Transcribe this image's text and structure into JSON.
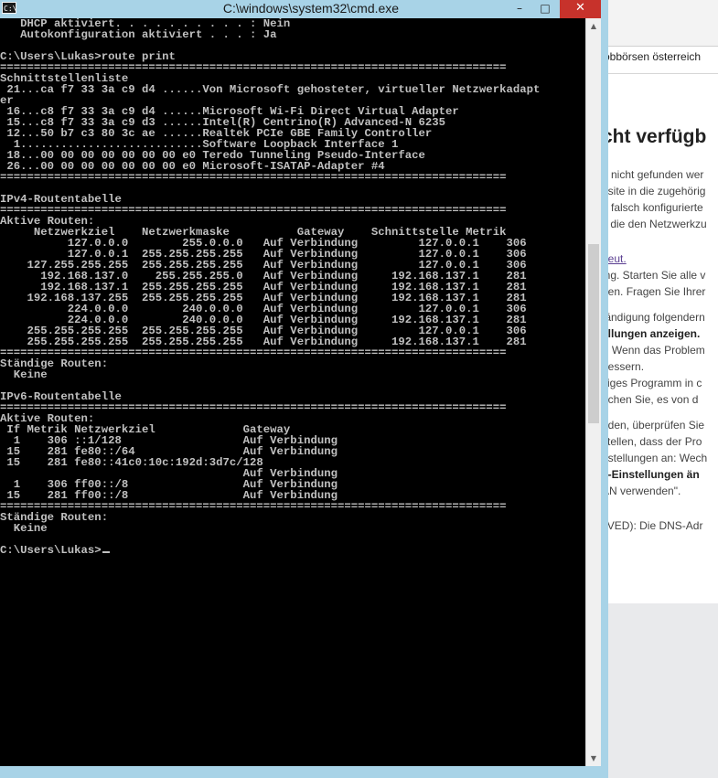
{
  "browser": {
    "bookmark": "obbörsen österreich",
    "heading": "cht verfügb",
    "lines": [
      {
        "text": "n nicht gefunden wer",
        "style": "p"
      },
      {
        "text": "osite in die zugehörig",
        "style": "p"
      },
      {
        "text": "n falsch konfigurierte",
        "style": "p"
      },
      {
        "text": "l, die den Netzwerkzu",
        "style": "p"
      },
      {
        "text": "",
        "style": "gap"
      },
      {
        "text": "",
        "style": "gap"
      },
      {
        "text": "neut.",
        "style": "link"
      },
      {
        "text": "ing. Starten Sie alle v",
        "style": "p"
      },
      {
        "text": "gen. Fragen Sie Ihrer",
        "style": "p"
      },
      {
        "text": "",
        "style": "gap"
      },
      {
        "text": "tändigung folgendern",
        "style": "p"
      },
      {
        "text": "ellungen anzeigen.",
        "style": "bold"
      },
      {
        "text": "\". Wenn das Problem",
        "style": "p"
      },
      {
        "text": "bessern.",
        "style": "p"
      },
      {
        "text": "siges Programm in c",
        "style": "p"
      },
      {
        "text": "uchen Sie, es von d",
        "style": "p"
      },
      {
        "text": "",
        "style": "gap"
      },
      {
        "text": "nden, überprüfen Sie",
        "style": "p"
      },
      {
        "text": "stellen, dass der Pro",
        "style": "p"
      },
      {
        "text": "nstellungen an: Wech",
        "style": "p"
      },
      {
        "text": "y-Einstellungen än",
        "style": "bold"
      },
      {
        "text": "AN verwenden\".",
        "style": "p"
      },
      {
        "text": "",
        "style": "gap"
      },
      {
        "text": "",
        "style": "gap"
      },
      {
        "text": "LVED): Die DNS-Adr",
        "style": "p"
      }
    ]
  },
  "window": {
    "title": "C:\\windows\\system32\\cmd.exe",
    "icon_label": "C:\\",
    "minimize": "–",
    "maximize": "□",
    "close": "✕"
  },
  "console": {
    "prompt_final": "C:\\Users\\Lukas>",
    "lines": [
      "   DHCP aktiviert. . . . . . . . . . : Nein",
      "   Autokonfiguration aktiviert . . . : Ja",
      "",
      "C:\\Users\\Lukas>route print",
      "===========================================================================",
      "Schnittstellenliste",
      " 21...ca f7 33 3a c9 d4 ......Von Microsoft gehosteter, virtueller Netzwerkadapt",
      "er",
      " 16...c8 f7 33 3a c9 d4 ......Microsoft Wi-Fi Direct Virtual Adapter",
      " 15...c8 f7 33 3a c9 d3 ......Intel(R) Centrino(R) Advanced-N 6235",
      " 12...50 b7 c3 80 3c ae ......Realtek PCIe GBE Family Controller",
      "  1...........................Software Loopback Interface 1",
      " 18...00 00 00 00 00 00 00 e0 Teredo Tunneling Pseudo-Interface",
      " 26...00 00 00 00 00 00 00 e0 Microsoft-ISATAP-Adapter #4",
      "===========================================================================",
      "",
      "IPv4-Routentabelle",
      "===========================================================================",
      "Aktive Routen:",
      "     Netzwerkziel    Netzwerkmaske          Gateway    Schnittstelle Metrik",
      "          127.0.0.0        255.0.0.0   Auf Verbindung         127.0.0.1    306",
      "          127.0.0.1  255.255.255.255   Auf Verbindung         127.0.0.1    306",
      "    127.255.255.255  255.255.255.255   Auf Verbindung         127.0.0.1    306",
      "      192.168.137.0    255.255.255.0   Auf Verbindung     192.168.137.1    281",
      "      192.168.137.1  255.255.255.255   Auf Verbindung     192.168.137.1    281",
      "    192.168.137.255  255.255.255.255   Auf Verbindung     192.168.137.1    281",
      "          224.0.0.0        240.0.0.0   Auf Verbindung         127.0.0.1    306",
      "          224.0.0.0        240.0.0.0   Auf Verbindung     192.168.137.1    281",
      "    255.255.255.255  255.255.255.255   Auf Verbindung         127.0.0.1    306",
      "    255.255.255.255  255.255.255.255   Auf Verbindung     192.168.137.1    281",
      "===========================================================================",
      "Ständige Routen:",
      "  Keine",
      "",
      "IPv6-Routentabelle",
      "===========================================================================",
      "Aktive Routen:",
      " If Metrik Netzwerkziel             Gateway",
      "  1    306 ::1/128                  Auf Verbindung",
      " 15    281 fe80::/64                Auf Verbindung",
      " 15    281 fe80::41c0:10c:192d:3d7c/128",
      "                                    Auf Verbindung",
      "  1    306 ff00::/8                 Auf Verbindung",
      " 15    281 ff00::/8                 Auf Verbindung",
      "===========================================================================",
      "Ständige Routen:",
      "  Keine",
      ""
    ]
  }
}
